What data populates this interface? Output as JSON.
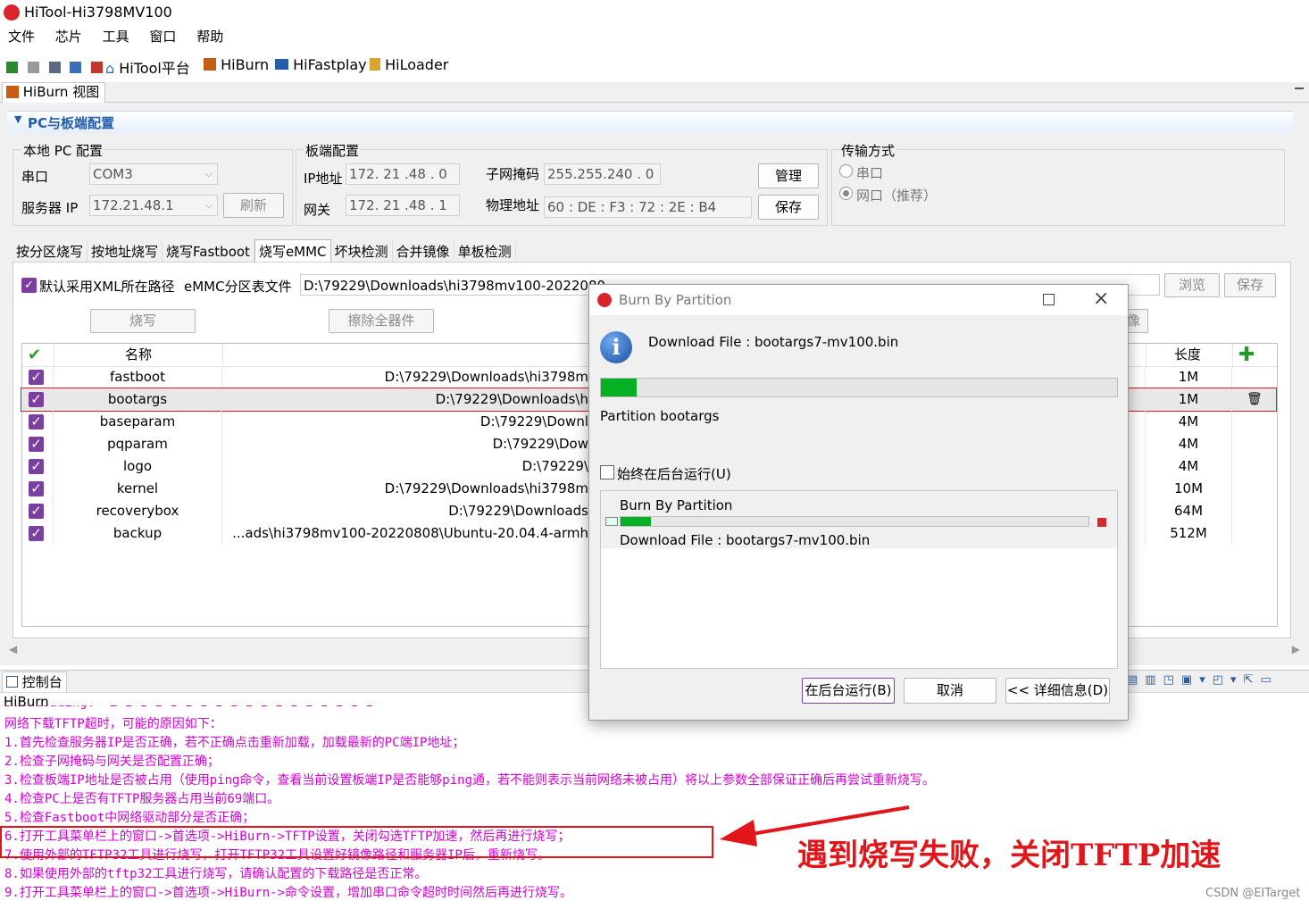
{
  "window": {
    "title": "HiTool-Hi3798MV100"
  },
  "menu": [
    "文件",
    "芯片",
    "工具",
    "窗口",
    "帮助"
  ],
  "toolbar": {
    "items": [
      "HiTool平台",
      "HiBurn",
      "HiFastplay",
      "HiLoader"
    ]
  },
  "view_tab": "HiBurn 视图",
  "section_title": "PC与板端配置",
  "local_pc": {
    "title": "本地 PC 配置",
    "serial_label": "串口",
    "serial_value": "COM3",
    "server_ip_label": "服务器 IP",
    "server_ip_value": "172.21.48.1",
    "refresh_label": "刷新"
  },
  "board": {
    "title": "板端配置",
    "ip_label": "IP地址",
    "ip_parts": [
      "172",
      "21",
      "48",
      "0"
    ],
    "gw_label": "网关",
    "gw_parts": [
      "172",
      "21",
      "48",
      "1"
    ],
    "mask_label": "子网掩码",
    "mask_parts": [
      "255",
      "255",
      "240",
      "0"
    ],
    "mac_label": "物理地址",
    "mac_parts": [
      "60",
      "DE",
      "F3",
      "72",
      "2E",
      "B4"
    ],
    "manage_label": "管理",
    "save_label": "保存"
  },
  "transfer": {
    "title": "传输方式",
    "opt_serial": "串口",
    "opt_net": "网口（推荐）"
  },
  "tabs": [
    "按分区烧写",
    "按地址烧写",
    "烧写Fastboot",
    "烧写eMMC",
    "坏块检测",
    "合并镜像",
    "单板检测"
  ],
  "emmc": {
    "xml_checkbox": "默认采用XML所在路径",
    "table_label": "eMMC分区表文件",
    "path": "D:\\79229\\Downloads\\hi3798mv100-2022080",
    "browse": "浏览",
    "save": "保存",
    "burn_btn": "烧写",
    "erase_btn": "擦除全器件",
    "image_btn": "像"
  },
  "table": {
    "header_name": "名称",
    "header_length": "长度",
    "rows": [
      {
        "name": "fastboot",
        "path": "D:\\79229\\Downloads\\hi3798m",
        "len": "1M"
      },
      {
        "name": "bootargs",
        "path": "D:\\79229\\Downloads\\h",
        "len": "1M"
      },
      {
        "name": "baseparam",
        "path": "D:\\79229\\Downl",
        "len": "4M"
      },
      {
        "name": "pqparam",
        "path": "D:\\79229\\Dow",
        "len": "4M"
      },
      {
        "name": "logo",
        "path": "D:\\79229\\",
        "len": "4M"
      },
      {
        "name": "kernel",
        "path": "D:\\79229\\Downloads\\hi3798m",
        "len": "10M"
      },
      {
        "name": "recoverybox",
        "path": "D:\\79229\\Downloads",
        "len": "64M"
      },
      {
        "name": "backup",
        "path": "...ads\\hi3798mv100-20220808\\Ubuntu-20.04.4-armh",
        "len": "512M"
      }
    ]
  },
  "console": {
    "tab": "控制台",
    "label": "HiBurn",
    "lines": [
      "Downloading: *Ш I I I I I I I I I I I I I I I I I",
      "网络下载TFTP超时，可能的原因如下：",
      "1.首先检查服务器IP是否正确，若不正确点击重新加载，加载最新的PC端IP地址；",
      "2.检查子网掩码与网关是否配置正确；",
      "3.检查板端IP地址是否被占用（使用ping命令，查看当前设置板端IP是否能够ping通，若不能则表示当前网络未被占用）将以上参数全部保证正确后再尝试重新烧写。",
      "4.检查PC上是否有TFTP服务器占用当前69端口。",
      "5.检查Fastboot中网络驱动部分是否正确；",
      "6.打开工具菜单栏上的窗口->首选项->HiBurn->TFTP设置，关闭勾选TFTP加速，然后再进行烧写；",
      "7.使用外部的TFTP32工具进行烧写，打开TFTP32工具设置好镜像路径和服务器IP后，重新烧写。",
      "8.如果使用外部的tftp32工具进行烧写，请确认配置的下载路径是否正常。",
      "9.打开工具菜单栏上的窗口->首选项->HiBurn->命令设置，增加串口命令超时时间然后再进行烧写。"
    ]
  },
  "dialog": {
    "title": "Burn By Partition",
    "message": "Download File : bootargs7-mv100.bin",
    "progress": 0.07,
    "sub_label": "Partition bootargs",
    "bg_checkbox": "始终在后台运行(U)",
    "job_title": "Burn By Partition",
    "job_progress": 0.065,
    "job_message": "Download File : bootargs7-mv100.bin",
    "btn_background": "在后台运行(B)",
    "btn_cancel": "取消",
    "btn_details": "<< 详细信息(D)"
  },
  "annotation": "遇到烧写失败，关闭TFTP加速",
  "watermark": "CSDN @EITarget",
  "colors": {
    "accent": "#7b3fa0",
    "console_text": "#d400d4",
    "annotation": "#e0161b",
    "progress": "#06b025"
  }
}
